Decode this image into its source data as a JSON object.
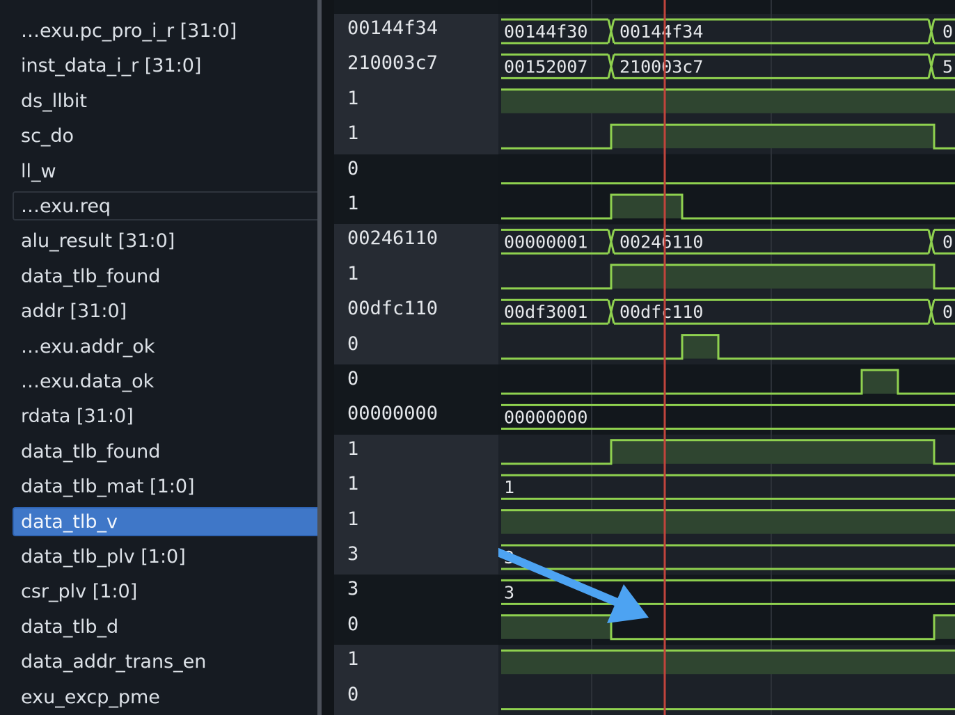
{
  "signals": [
    {
      "name": "…exu.pc_pro_i_r [31:0]",
      "value": "00144f34"
    },
    {
      "name": "inst_data_i_r [31:0]",
      "value": "210003c7"
    },
    {
      "name": "ds_llbit",
      "value": "1"
    },
    {
      "name": "sc_do",
      "value": "1"
    },
    {
      "name": "ll_w",
      "value": "0"
    },
    {
      "name": "…exu.req",
      "value": "1",
      "focused": true
    },
    {
      "name": "alu_result [31:0]",
      "value": "00246110"
    },
    {
      "name": "data_tlb_found",
      "value": "1"
    },
    {
      "name": "addr [31:0]",
      "value": "00dfc110"
    },
    {
      "name": "…exu.addr_ok",
      "value": "0"
    },
    {
      "name": "…exu.data_ok",
      "value": "0"
    },
    {
      "name": "rdata [31:0]",
      "value": "00000000"
    },
    {
      "name": "data_tlb_found",
      "value": "1"
    },
    {
      "name": "data_tlb_mat [1:0]",
      "value": "1"
    },
    {
      "name": "data_tlb_v",
      "value": "1",
      "selected": true
    },
    {
      "name": "data_tlb_plv [1:0]",
      "value": "3"
    },
    {
      "name": "csr_plv [1:0]",
      "value": "3"
    },
    {
      "name": "data_tlb_d",
      "value": "0"
    },
    {
      "name": "data_addr_trans_en",
      "value": "1"
    },
    {
      "name": "exu_excp_pme",
      "value": "0"
    }
  ],
  "waves": [
    {
      "kind": "bus",
      "segments": [
        {
          "value": "00144f30"
        },
        {
          "value": "00144f34"
        },
        {
          "value": "0"
        }
      ]
    },
    {
      "kind": "bus",
      "segments": [
        {
          "value": "00152007"
        },
        {
          "value": "210003c7"
        },
        {
          "value": "5"
        }
      ]
    },
    {
      "kind": "bit",
      "levels": [
        1
      ]
    },
    {
      "kind": "bit",
      "levels": [
        0,
        1,
        0
      ]
    },
    {
      "kind": "bit",
      "levels": [
        0
      ]
    },
    {
      "kind": "bit",
      "levels": [
        0,
        1,
        0
      ]
    },
    {
      "kind": "bus",
      "segments": [
        {
          "value": "00000001"
        },
        {
          "value": "00246110"
        },
        {
          "value": "0"
        }
      ]
    },
    {
      "kind": "bit",
      "levels": [
        0,
        1,
        0
      ]
    },
    {
      "kind": "bus",
      "segments": [
        {
          "value": "00df3001"
        },
        {
          "value": "00dfc110"
        },
        {
          "value": "0"
        }
      ]
    },
    {
      "kind": "bit",
      "levels": [
        0,
        1,
        0
      ]
    },
    {
      "kind": "bit",
      "levels": [
        0,
        1,
        0
      ]
    },
    {
      "kind": "bus",
      "segments": [
        {
          "value": "00000000"
        }
      ]
    },
    {
      "kind": "bit",
      "levels": [
        0,
        1,
        0
      ]
    },
    {
      "kind": "bus",
      "segments": [
        {
          "value": "1"
        }
      ]
    },
    {
      "kind": "bit",
      "levels": [
        1
      ]
    },
    {
      "kind": "bus",
      "segments": [
        {
          "value": "3"
        }
      ]
    },
    {
      "kind": "bus",
      "segments": [
        {
          "value": "3"
        }
      ]
    },
    {
      "kind": "bit",
      "levels": [
        1,
        0,
        1
      ]
    },
    {
      "kind": "bit",
      "levels": [
        1
      ]
    },
    {
      "kind": "bit",
      "levels": [
        0
      ]
    }
  ],
  "colors": {
    "wave": "#8fd14f",
    "wave_fill": "#2f4530",
    "cursor": "#c0443c",
    "arrow": "#4da3f2",
    "selection": "#3f77c8"
  },
  "icons": {
    "annotation": "arrow-icon"
  }
}
